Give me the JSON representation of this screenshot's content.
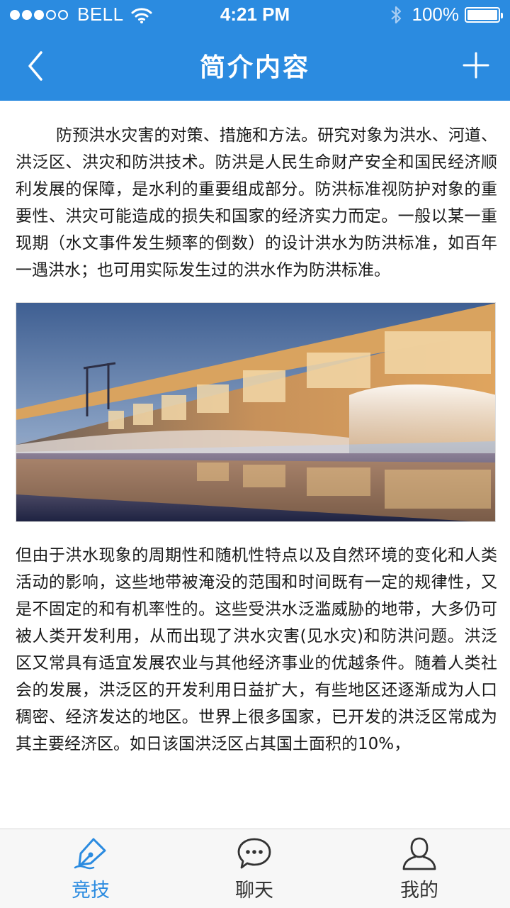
{
  "status_bar": {
    "carrier": "BELL",
    "time": "4:21 PM",
    "battery": "100%",
    "signal_bars_filled": 3,
    "signal_bars_total": 5,
    "battery_level": 1.0
  },
  "nav": {
    "title": "简介内容",
    "back_icon": "chevron-left-icon",
    "add_icon": "plus-icon"
  },
  "article": {
    "paragraph1": "防预洪水灾害的对策、措施和方法。研究对象为洪水、河道、洪泛区、洪灾和防洪技术。防洪是人民生命财产安全和国民经济顺利发展的保障，是水利的重要组成部分。防洪标准视防护对象的重要性、洪灾可能造成的损失和国家的经济实力而定。一般以某一重现期（水文事件发生频率的倒数）的设计洪水为防洪标准，如百年一遇洪水；也可用实际发生过的洪水作为防洪标准。",
    "paragraph2": "但由于洪水现象的周期性和随机性特点以及自然环境的变化和人类活动的影响，这些地带被淹没的范围和时间既有一定的规律性，又是不固定的和有机率性的。这些受洪水泛滥威胁的地带，大多仍可被人类开发利用，从而出现了洪水灾害(见水灾)和防洪问题。洪泛区又常具有适宜发展农业与其他经济事业的优越条件。随着人类社会的发展，洪泛区的开发利用日益扩大，有些地区还逐渐成为人口稠密、经济发达的地区。世界上很多国家，已开发的洪泛区常成为其主要经济区。如日该国洪泛区占其国土面积的10%，"
  },
  "tabbar": {
    "tabs": [
      {
        "label": "竞技",
        "icon": "pen-nib-icon",
        "active": true
      },
      {
        "label": "聊天",
        "icon": "chat-bubble-icon",
        "active": false
      },
      {
        "label": "我的",
        "icon": "person-icon",
        "active": false
      }
    ]
  },
  "colors": {
    "accent": "#2b8be0",
    "tabbar_bg": "#f7f7f7",
    "text": "#1a1a1a"
  }
}
